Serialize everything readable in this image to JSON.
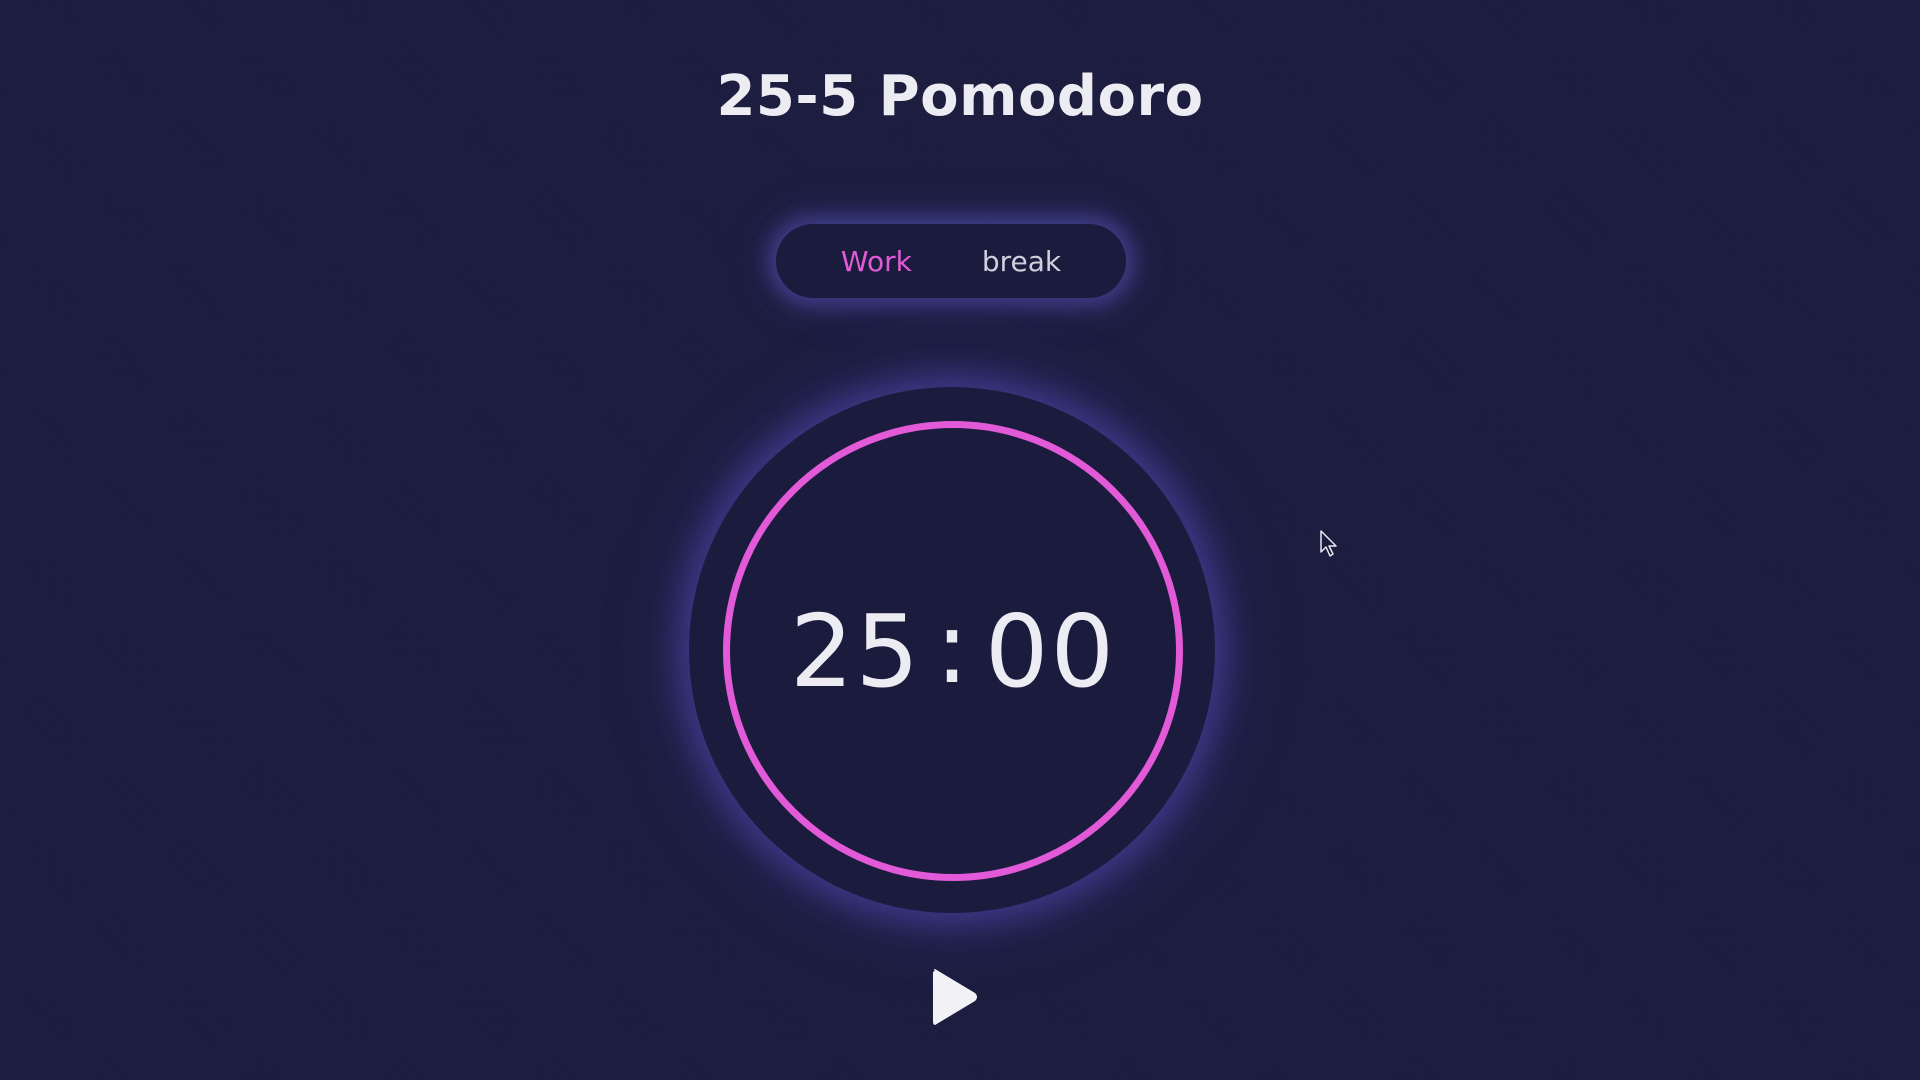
{
  "app": {
    "title": "25-5 Pomodoro"
  },
  "mode_toggle": {
    "options": [
      {
        "label": "Work",
        "active": true
      },
      {
        "label": "break",
        "active": false
      }
    ]
  },
  "timer": {
    "minutes": "25",
    "separator": ":",
    "seconds": "00"
  },
  "controls": {
    "play_icon": "play-icon"
  },
  "colors": {
    "background": "#1c1c40",
    "accent": "#e35ad8",
    "glow": "#5f5ac8",
    "text": "#ececf2"
  }
}
